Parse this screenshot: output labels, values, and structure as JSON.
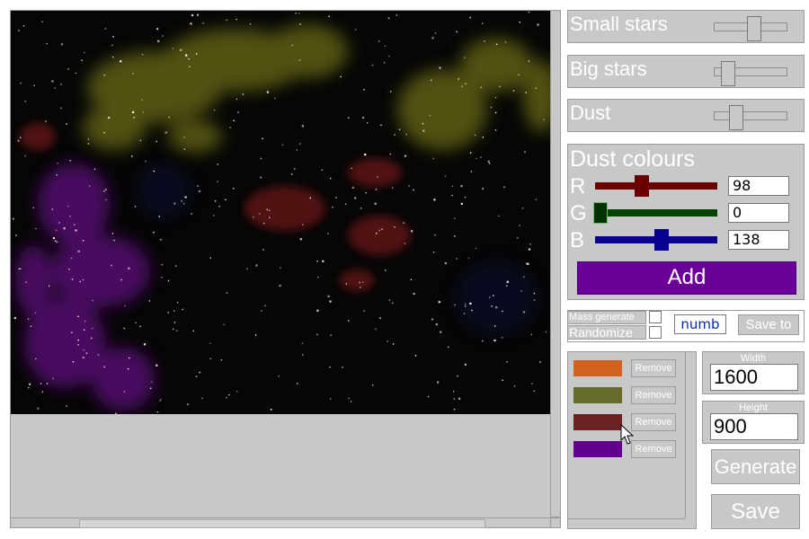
{
  "sliders": {
    "small_stars": {
      "label": "Small stars",
      "level": 0.55
    },
    "big_stars": {
      "label": "Big stars",
      "level": 0.2
    },
    "dust": {
      "label": "Dust",
      "level": 0.3
    }
  },
  "dust_colours": {
    "title": "Dust colours",
    "channels": [
      {
        "label": "R",
        "value": "98",
        "level": 0.384,
        "bar_color": "#6b0000",
        "thumb_color": "#6b0000"
      },
      {
        "label": "G",
        "value": "0",
        "level": 0.0,
        "bar_color": "#004400",
        "thumb_color": "#003300"
      },
      {
        "label": "B",
        "value": "138",
        "level": 0.541,
        "bar_color": "#0a0090",
        "thumb_color": "#0a0090"
      }
    ],
    "add_label": "Add"
  },
  "mass": {
    "mass_generate_label": "Mass generate",
    "randomize_label": "Randomize",
    "count_value": "numb",
    "save_to_label": "Save to"
  },
  "colour_list": {
    "remove_label": "Remove",
    "swatches": [
      "#d2631f",
      "#666a2a",
      "#6a2322",
      "#640090"
    ]
  },
  "size": {
    "width_label": "Width",
    "width_value": "1600",
    "height_label": "Height",
    "height_value": "900"
  },
  "actions": {
    "generate_label": "Generate",
    "save_label": "Save"
  }
}
